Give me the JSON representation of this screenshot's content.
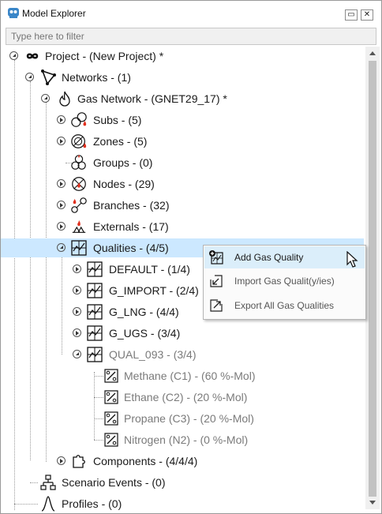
{
  "window": {
    "title": "Model Explorer",
    "minimize_glyph": "▭",
    "close_glyph": "✕"
  },
  "filter": {
    "placeholder": "Type here to filter"
  },
  "tree": {
    "project": "Project - (New Project) *",
    "networks": "Networks - (1)",
    "gas_network": "Gas Network - (GNET29_17) *",
    "subs": "Subs - (5)",
    "zones": "Zones - (5)",
    "groups": "Groups - (0)",
    "nodes": "Nodes - (29)",
    "branches": "Branches - (32)",
    "externals": "Externals - (17)",
    "qualities": "Qualities - (4/5)",
    "q_default": "DEFAULT - (1/4)",
    "q_g_import": "G_IMPORT - (2/4)",
    "q_g_lng": "G_LNG - (4/4)",
    "q_g_ugs": "G_UGS - (3/4)",
    "q_qual_093": "QUAL_093 - (3/4)",
    "methane": "Methane (C1) - (60 %-Mol)",
    "ethane": "Ethane (C2) - (20 %-Mol)",
    "propane": "Propane (C3) - (20 %-Mol)",
    "nitrogen": "Nitrogen (N2) - (0 %-Mol)",
    "components": "Components - (4/4/4)",
    "scenario_events": "Scenario Events - (0)",
    "profiles": "Profiles - (0)"
  },
  "context_menu": {
    "add": "Add Gas Quality",
    "import": "Import Gas Qualit(y/ies)",
    "export": "Export All Gas Qualities"
  },
  "colors": {
    "selection": "#cce8ff",
    "menu_highlight": "#dbeefa",
    "scroll_thumb": "#c2c2c2"
  }
}
